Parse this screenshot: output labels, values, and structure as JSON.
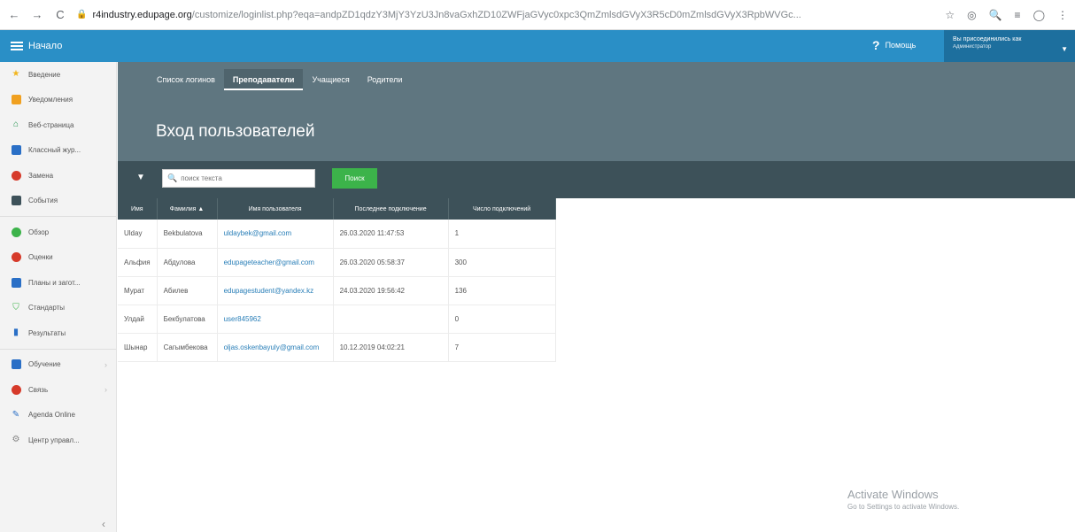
{
  "browser": {
    "url_host": "r4industry.edupage.org",
    "url_rest": "/customize/loginlist.php?eqa=andpZD1qdzY3MjY3YzU3Jn8vaGxhZD10ZWFjaGVyc0xpc3QmZmlsdGVyX3R5cD0mZmlsdGVyX3RpbWVGc...",
    "back_icon": "arrow-left-icon",
    "forward_icon": "arrow-right-icon",
    "reload_icon": "reload-icon"
  },
  "topbar": {
    "home_label": "Начало",
    "help_label": "Помощь",
    "login_as_line1": "Вы присоединились как",
    "login_as_role": "Администратор",
    "accent_color": "#2a8fc6"
  },
  "sidebar": {
    "items": [
      {
        "label": "Введение",
        "icon": "star-icon"
      },
      {
        "label": "Уведомления",
        "icon": "notification-icon"
      },
      {
        "label": "Веб-страница",
        "icon": "home-icon"
      },
      {
        "label": "Классный жур...",
        "icon": "book-icon"
      },
      {
        "label": "Замена",
        "icon": "person-icon"
      },
      {
        "label": "События",
        "icon": "calendar-icon"
      },
      {
        "label": "Обзор",
        "icon": "overview-icon"
      },
      {
        "label": "Оценки",
        "icon": "grades-icon"
      },
      {
        "label": "Планы и загот...",
        "icon": "plans-icon"
      },
      {
        "label": "Стандарты",
        "icon": "shield-icon"
      },
      {
        "label": "Результаты",
        "icon": "bar-chart-icon"
      },
      {
        "label": "Обучение",
        "icon": "graduation-icon"
      },
      {
        "label": "Связь",
        "icon": "people-icon"
      },
      {
        "label": "Agenda Online",
        "icon": "pen-icon"
      },
      {
        "label": "Центр управл...",
        "icon": "gear-icon"
      }
    ]
  },
  "tabs": [
    "Список логинов",
    "Преподаватели",
    "Учащиеся",
    "Родители"
  ],
  "page_title": "Вход пользователей",
  "search": {
    "placeholder": "поиск текста",
    "button_label": "Поиск"
  },
  "table": {
    "headers": [
      "Имя",
      "Фамилия ▲",
      "Имя пользователя",
      "Последнее подключение",
      "Число подключений"
    ],
    "rows": [
      [
        "Ulday",
        "Bekbulatova",
        "uldaybek@gmail.com",
        "26.03.2020 11:47:53",
        "1"
      ],
      [
        "Альфия",
        "Абдулова",
        "edupageteacher@gmail.com",
        "26.03.2020 05:58:37",
        "300"
      ],
      [
        "Мурат",
        "Абилев",
        "edupagestudent@yandex.kz",
        "24.03.2020 19:56:42",
        "136"
      ],
      [
        "Улдай",
        "Бекбулатова",
        "user845962",
        "",
        "0"
      ],
      [
        "Шынар",
        "Сагымбекова",
        "oljas.oskenbayuly@gmail.com",
        "10.12.2019 04:02:21",
        "7"
      ]
    ]
  },
  "watermark": {
    "line1": "Activate Windows",
    "line2": "Go to Settings to activate Windows."
  }
}
